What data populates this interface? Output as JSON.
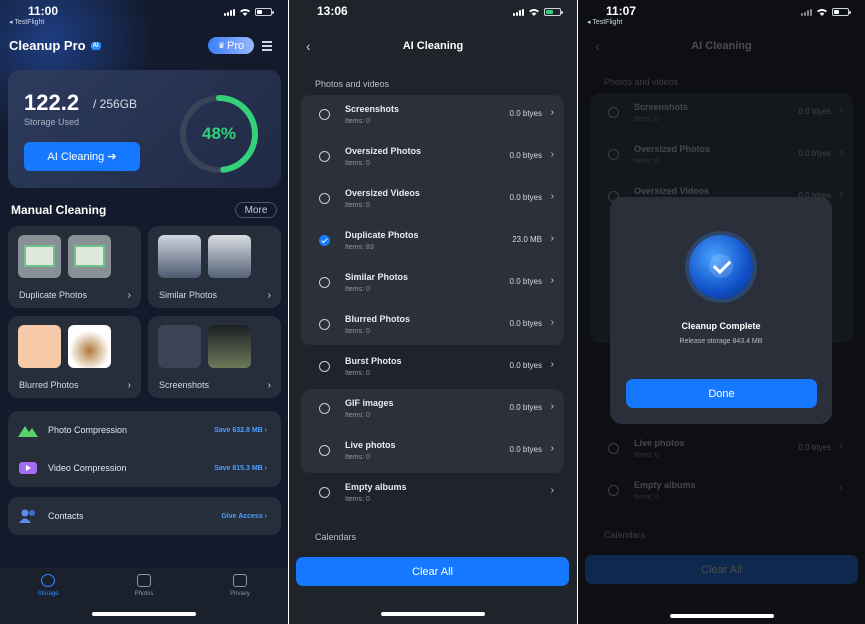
{
  "screen1": {
    "status": {
      "time": "11:00",
      "back_label": "◂ TestFlight"
    },
    "app_title": "Cleanup Pro",
    "ai_badge": "AI",
    "pro_label": "Pro",
    "storage": {
      "used": "122.2",
      "total": "/ 256GB",
      "label": "Storage Used",
      "percent_text": "48%",
      "percent": 0.48
    },
    "ai_cleaning_button": "AI Cleaning ➔",
    "manual_cleaning": "Manual Cleaning",
    "more": "More",
    "tiles": [
      {
        "label": "Duplicate Photos"
      },
      {
        "label": "Similar Photos"
      },
      {
        "label": "Blurred Photos"
      },
      {
        "label": "Screenshots"
      }
    ],
    "compression": [
      {
        "label": "Photo Compression",
        "save": "Save 632.8 MB ›"
      },
      {
        "label": "Video Compression",
        "save": "Save 815.3 MB ›"
      }
    ],
    "contacts": {
      "label": "Contacts",
      "action": "Give Access ›"
    },
    "tabs": [
      {
        "label": "Storage"
      },
      {
        "label": "Photos"
      },
      {
        "label": "Privacy"
      }
    ],
    "colors": {
      "accent": "#1677ff",
      "ring": "#34d07a"
    }
  },
  "screen2": {
    "status": {
      "time": "13:06"
    },
    "title": "AI Cleaning",
    "section_photos": "Photos and videos",
    "items": [
      {
        "name": "Screenshots",
        "sub": "Items: 0",
        "size": "0.0 btyes"
      },
      {
        "name": "Oversized Photos",
        "sub": "Items: 0",
        "size": "0.0 btyes"
      },
      {
        "name": "Oversized Videos",
        "sub": "Items: 0",
        "size": "0.0 btyes"
      },
      {
        "name": "Duplicate Photos",
        "sub": "Items: 83",
        "size": "23.0 MB",
        "checked": true
      },
      {
        "name": "Similar Photos",
        "sub": "Items: 0",
        "size": "0.0 btyes"
      },
      {
        "name": "Blurred Photos",
        "sub": "Items: 0",
        "size": "0.0 btyes"
      },
      {
        "name": "Burst Photos",
        "sub": "Items: 0",
        "size": "0.0 btyes"
      },
      {
        "name": "GIF images",
        "sub": "Items: 0",
        "size": "0.0 btyes"
      },
      {
        "name": "Live photos",
        "sub": "Items: 0",
        "size": "0.0 btyes"
      },
      {
        "name": "Empty albums",
        "sub": "Items: 0",
        "size": ""
      }
    ],
    "section_calendars": "Calendars",
    "clear_all": "Clear All"
  },
  "screen3": {
    "status": {
      "time": "11:07",
      "back_label": "◂ TestFlight"
    },
    "title": "AI Cleaning",
    "section_photos": "Photos and videos",
    "items": [
      {
        "name": "Screenshots",
        "sub": "Items: 0",
        "size": "0.0 btyes"
      },
      {
        "name": "Oversized Photos",
        "sub": "Items: 0",
        "size": "0.0 btyes"
      },
      {
        "name": "Oversized Videos",
        "sub": "Items: 0",
        "size": "0.0 btyes"
      },
      {
        "name": "Live photos",
        "sub": "Items: 0",
        "size": "0.0 btyes"
      },
      {
        "name": "Empty albums",
        "sub": "Items: 0",
        "size": ""
      }
    ],
    "section_calendars": "Calendars",
    "clear_all": "Clear All",
    "modal": {
      "title": "Cleanup Complete",
      "subtitle": "Release storage 843.4 MB",
      "done": "Done"
    }
  }
}
